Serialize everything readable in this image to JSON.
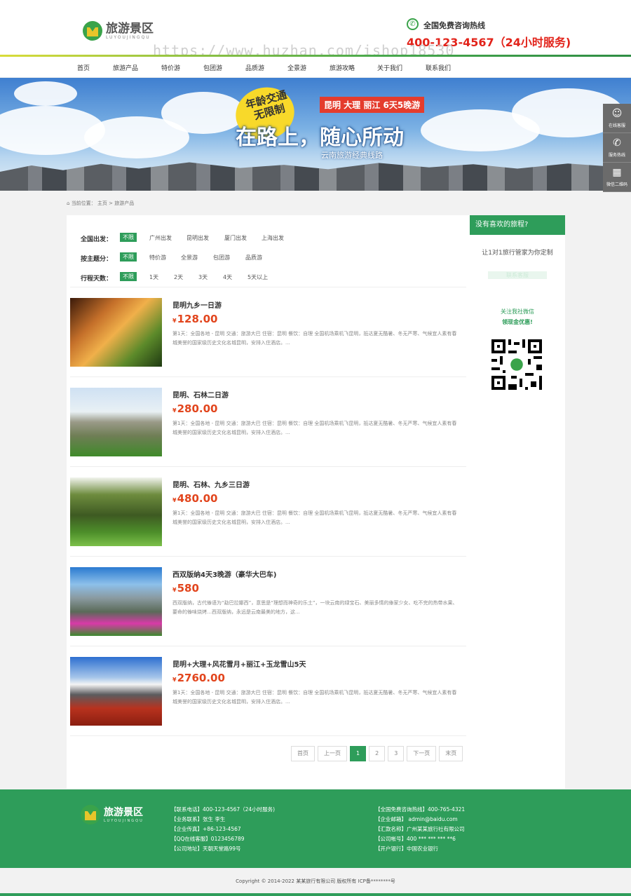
{
  "header": {
    "logo_cn": "旅游景区",
    "logo_en": "LUYOUJINGQU",
    "hotline_label": "全国免费咨询热线",
    "hotline_number": "400-123-4567（24小时服务)",
    "watermark": "https://www.huzhan.com/ishop18530"
  },
  "nav": [
    "首页",
    "旅游产品",
    "特价游",
    "包团游",
    "品质游",
    "全景游",
    "旅游攻略",
    "关于我们",
    "联系我们"
  ],
  "banner": {
    "badge_line1": "年龄交通",
    "badge_line2": "无限制",
    "route": "昆明 大理 丽江 6天5晚游",
    "slogan": "在路上，随心所动",
    "subtitle": "云南旅游经典线路"
  },
  "float_sidebar": [
    {
      "icon": "headset-icon",
      "label": "在线客服"
    },
    {
      "icon": "phone-icon",
      "label": "服务热线"
    },
    {
      "icon": "qrcode-icon",
      "label": "微信二维码"
    }
  ],
  "breadcrumb": {
    "prefix": "当前位置：",
    "home": "主页",
    "sep": ">",
    "current": "旅游产品"
  },
  "filters": [
    {
      "label": "全国出发：",
      "options": [
        "不限",
        "广州出发",
        "昆明出发",
        "厦门出发",
        "上海出发"
      ]
    },
    {
      "label": "按主题分：",
      "options": [
        "不限",
        "特价游",
        "全景游",
        "包团游",
        "品质游"
      ]
    },
    {
      "label": "行程天数：",
      "options": [
        "不限",
        "1天",
        "2天",
        "3天",
        "4天",
        "5天以上"
      ]
    }
  ],
  "tours": [
    {
      "title": "昆明九乡一日游",
      "currency": "¥",
      "price": "128.00",
      "desc": "第1天：全国各地 - 昆明 交通：旅游大巴 住宿：昆明 餐饮：自理 全国机场乘机飞昆明，抵达夏无酷暑、冬无严寒、气候宜人素有春城美誉的国家级历史文化名城昆明，安排入住酒店。..."
    },
    {
      "title": "昆明、石林二日游",
      "currency": "¥",
      "price": "280.00",
      "desc": "第1天：全国各地 - 昆明 交通：旅游大巴 住宿：昆明 餐饮：自理 全国机场乘机飞昆明，抵达夏无酷暑、冬无严寒、气候宜人素有春城美誉的国家级历史文化名城昆明，安排入住酒店。..."
    },
    {
      "title": "昆明、石林、九乡三日游",
      "currency": "¥",
      "price": "480.00",
      "desc": "第1天：全国各地 - 昆明 交通：旅游大巴 住宿：昆明 餐饮：自理 全国机场乘机飞昆明，抵达夏无酷暑、冬无严寒、气候宜人素有春城美誉的国家级历史文化名城昆明，安排入住酒店。..."
    },
    {
      "title": "西双版纳4天3晚游（豪华大巴车)",
      "currency": "¥",
      "price": "580",
      "desc": "西双版纳，古代傣语为“勐巴拉娜西”，意思是“理想而神奇的乐土”，一块云南的绿宝石、美丽多情的傣家少女、吃不完的热带水果、要命的傣味烧烤…西双版纳，永远是云南最美的地方，这..."
    },
    {
      "title": "昆明+大理+风花雪月+丽江+玉龙雪山5天",
      "currency": "¥",
      "price": "2760.00",
      "desc": "第1天：全国各地 - 昆明 交通：旅游大巴 住宿：昆明 餐饮：自理 全国机场乘机飞昆明，抵达夏无酷暑、冬无严寒、气候宜人素有春城美誉的国家级历史文化名城昆明，安排入住酒店。..."
    }
  ],
  "pagination": {
    "first": "首页",
    "prev": "上一页",
    "pages": [
      "1",
      "2",
      "3"
    ],
    "current": "1",
    "next": "下一页",
    "last": "末页"
  },
  "aside": {
    "head": "没有喜欢的旅程?",
    "text": "让1对1旅行管家为你定制",
    "button": "联系客服",
    "wechat_line1": "关注我社微信",
    "wechat_line2": "领现金优惠!"
  },
  "footer": {
    "logo_cn": "旅游景区",
    "logo_en": "LUYOUJINGQU",
    "col1": [
      "【联系电话】400-123-4567（24小时服务)",
      "【业务联系】张生 李生",
      "【企业传真】+86-123-4567",
      "【QQ在线客服】0123456789",
      "【公司地址】天朝天堂路99号"
    ],
    "col2": [
      "【全国免费咨询热线】400-765-4321",
      "【企业邮箱】 admin@baidu.com",
      "【汇款名称】广州某某旅行社有限公司",
      "【公司帐号】400 *** *** *** **6",
      "【开户银行】中国农业银行"
    ],
    "copyright": "Copyright © 2014-2022 某某旅行有限公司 版权所有    ICP备********号"
  },
  "colors": {
    "brand_green": "#2e9d5a",
    "price_red": "#e2451d",
    "hotline_red": "#e2231a"
  }
}
